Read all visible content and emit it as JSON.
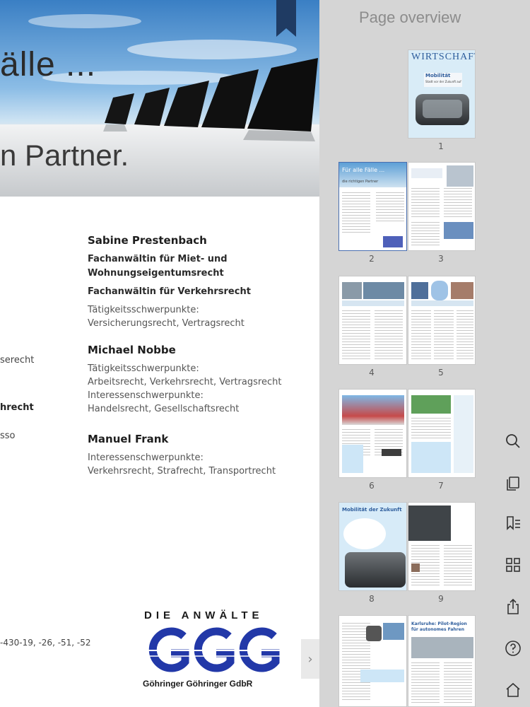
{
  "page": {
    "hero_title": "älle ...",
    "hero_subtitle": "n Partner.",
    "lawyers": [
      {
        "name": "Sabine Prestenbach",
        "titles": [
          "Fachanwältin für Miet- und",
          "Wohnungseigentumsrecht",
          "Fachanwältin für Verkehrsrecht"
        ],
        "lines": [
          "Tätigkeitsschwerpunkte:",
          "Versicherungsrecht, Vertragsrecht"
        ]
      },
      {
        "name": "Michael Nobbe",
        "lines": [
          "Tätigkeitsschwerpunkte:",
          "Arbeitsrecht, Verkehrsrecht, Vertragsrecht",
          "Interessenschwerpunkte:",
          "Handelsrecht, Gesellschaftsrecht"
        ]
      },
      {
        "name": "Manuel Frank",
        "lines": [
          "Interessenschwerpunkte:",
          "Verkehrsrecht, Strafrecht, Transportrecht"
        ]
      }
    ],
    "cut_text": [
      "serecht",
      "hrecht",
      "sso",
      "-430-19, -26, -51, -52"
    ],
    "logo": {
      "top": "DIE ANWÄLTE",
      "mark": "GGG",
      "bottom": "Göhringer  Göhringer  GdbR",
      "color": "#2238a8"
    }
  },
  "overview": {
    "title": "Page overview",
    "cover_brand": "WIRTSCHAFT",
    "cover_headline": "Mobilität",
    "cover_sub": "Stadt vor der Zukunft auf",
    "p2_title": "Für alle Fälle ...",
    "p2_subtitle": "die richtigen Partner",
    "p8_title": "Mobilität der Zukunft",
    "p10_title": "Karlsruhe: Pilot-Region",
    "p10_subtitle": "für autonomes Fahren",
    "page_numbers": [
      "1",
      "2",
      "3",
      "4",
      "5",
      "6",
      "7",
      "8",
      "9"
    ],
    "selected_page": "2"
  },
  "tools": [
    "search-icon",
    "copy-pages-icon",
    "bookmark-list-icon",
    "grid-icon",
    "share-icon",
    "help-icon",
    "home-icon"
  ],
  "colors": {
    "accent": "#4a6fb0",
    "ribbon": "#1f3b63",
    "panel": "#d5d5d5"
  }
}
